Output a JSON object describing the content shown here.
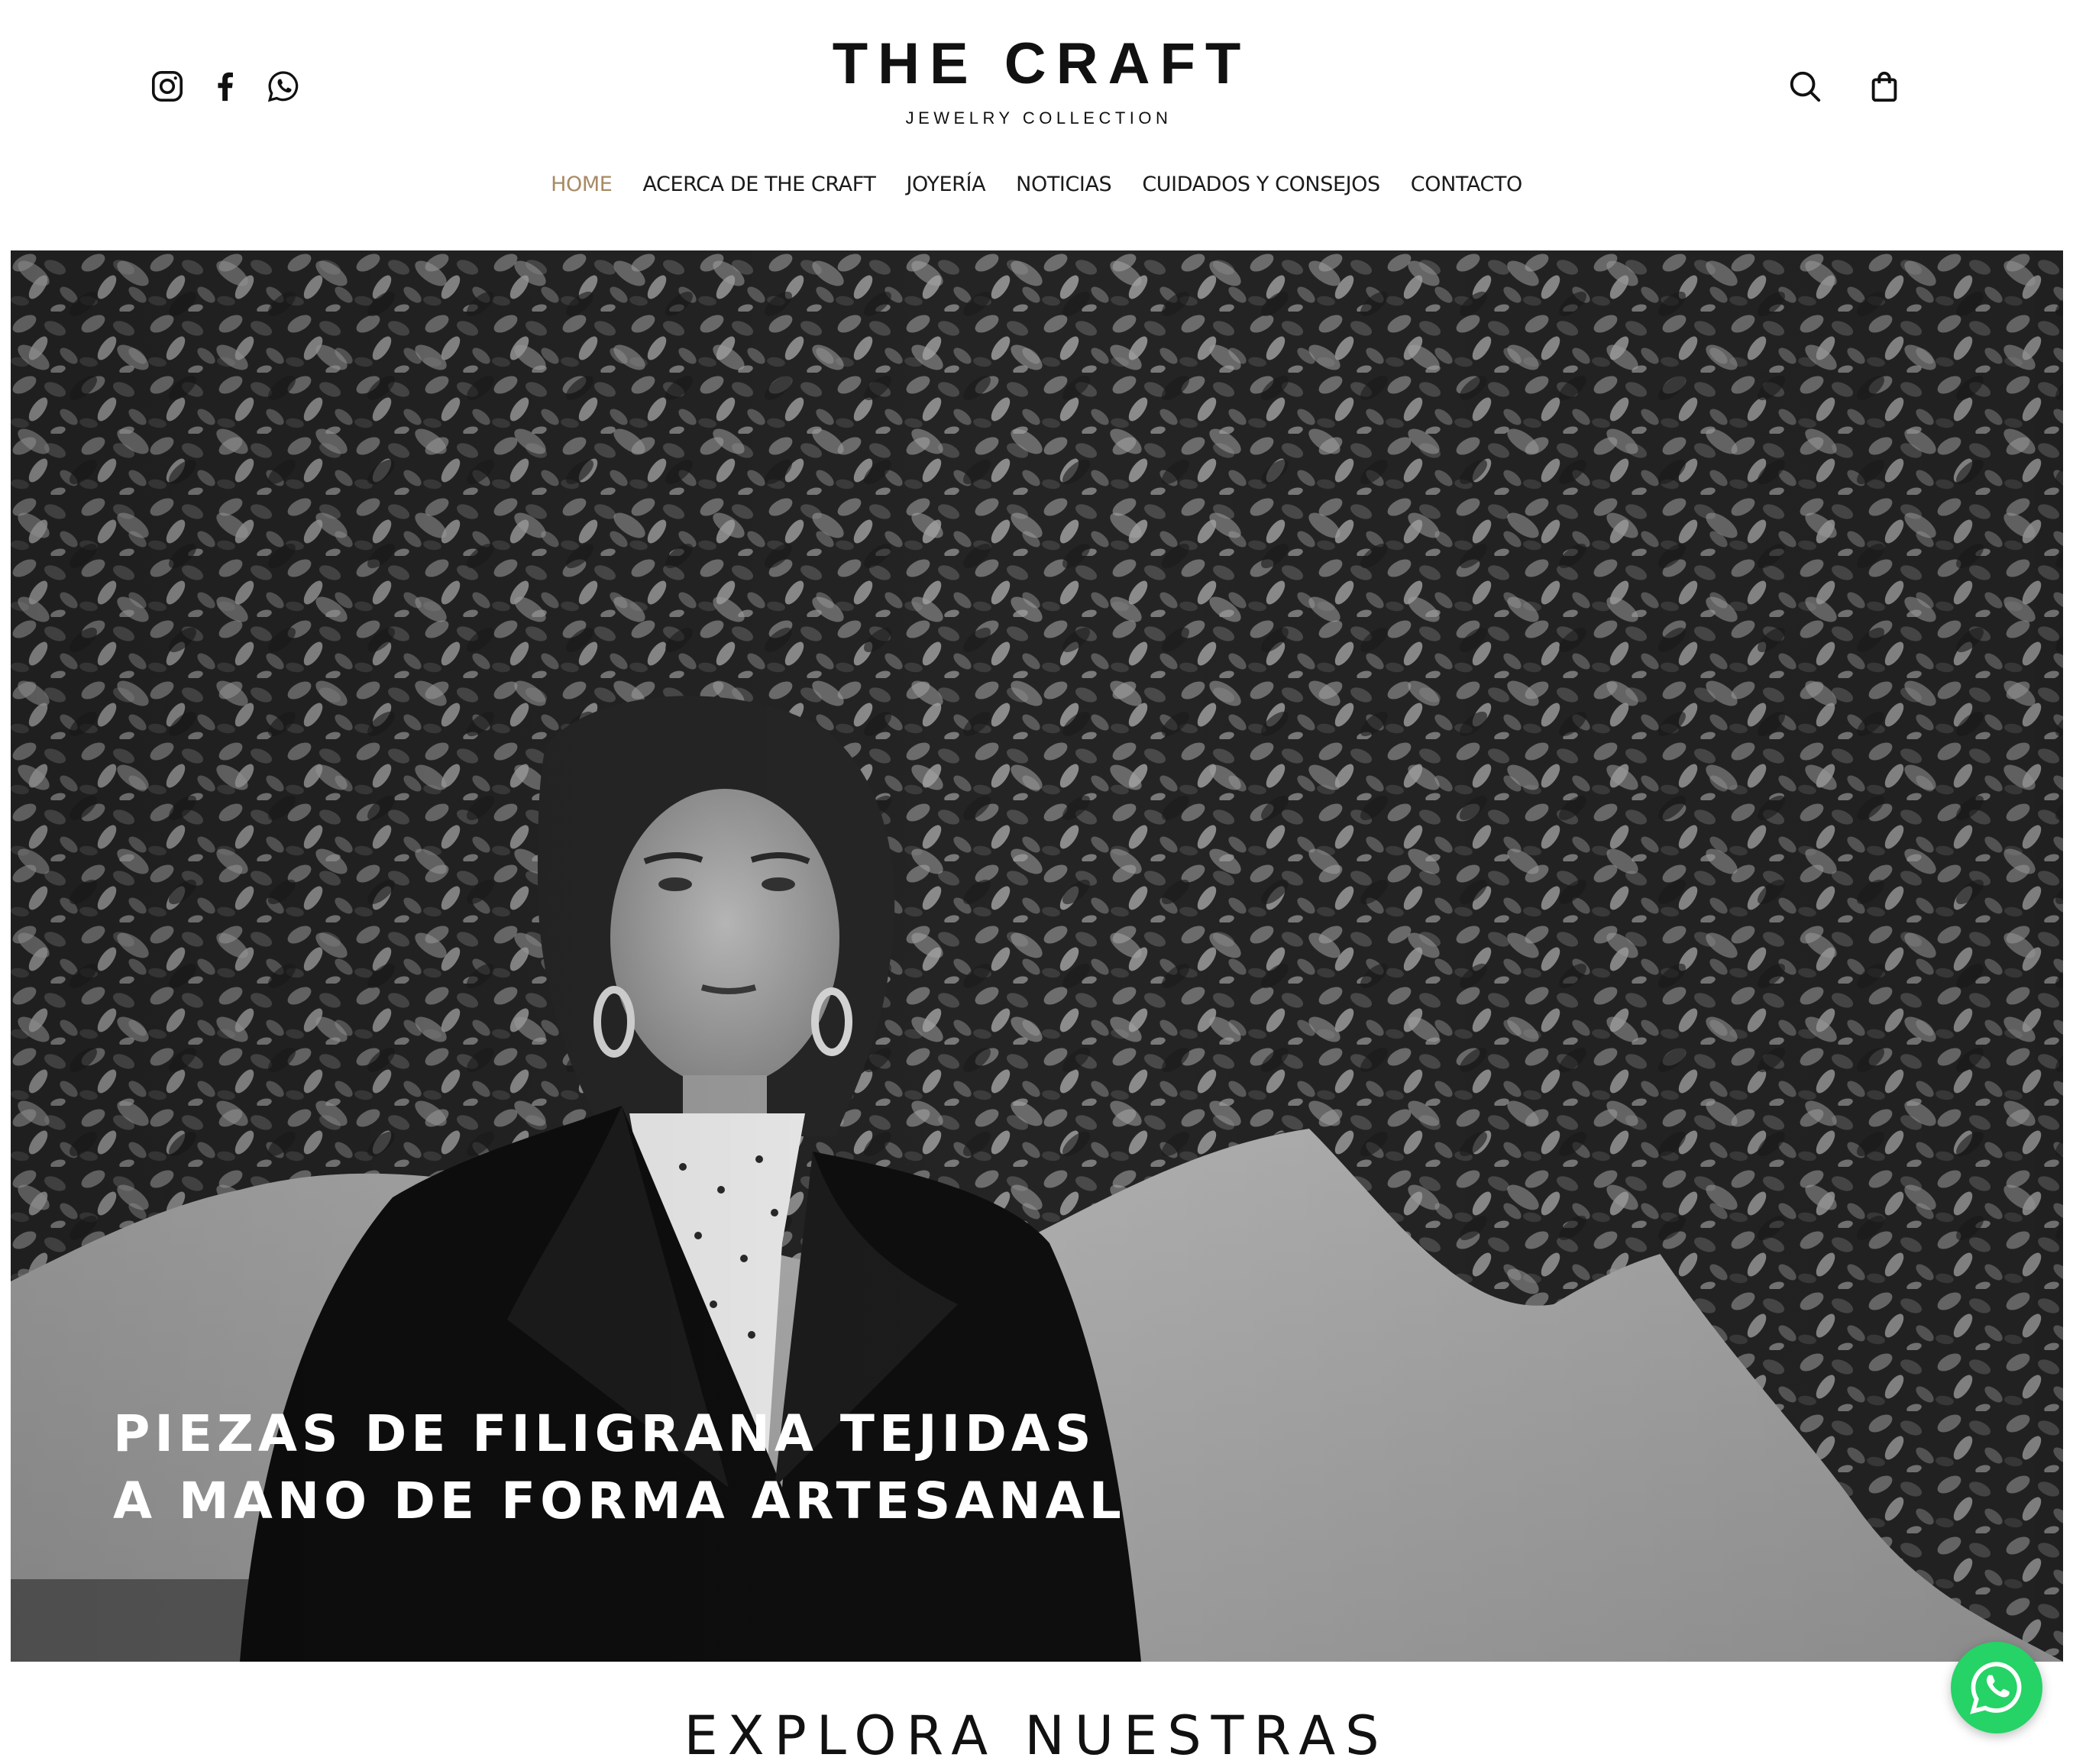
{
  "brand": {
    "title": "THE CRAFT",
    "subtitle": "JEWELRY COLLECTION"
  },
  "social": {
    "icons": [
      "instagram-icon",
      "facebook-icon",
      "whatsapp-icon"
    ]
  },
  "utility": {
    "icons": [
      "search-icon",
      "shopping-bag-icon"
    ]
  },
  "nav": {
    "items": [
      {
        "label": "HOME",
        "active": true
      },
      {
        "label": "ACERCA DE THE CRAFT",
        "active": false
      },
      {
        "label": "JOYERÍA",
        "active": false
      },
      {
        "label": "NOTICIAS",
        "active": false
      },
      {
        "label": "CUIDADOS Y CONSEJOS",
        "active": false
      },
      {
        "label": "CONTACTO",
        "active": false
      }
    ]
  },
  "hero": {
    "caption_line1": "PIEZAS DE FILIGRANA TEJIDAS",
    "caption_line2": "A MANO DE FORMA ARTESANAL"
  },
  "section": {
    "heading": "EXPLORA NUESTRAS"
  },
  "floating": {
    "icon": "whatsapp-icon"
  },
  "colors": {
    "accent": "#a88a63",
    "text": "#111111",
    "whatsapp": "#25d366"
  }
}
